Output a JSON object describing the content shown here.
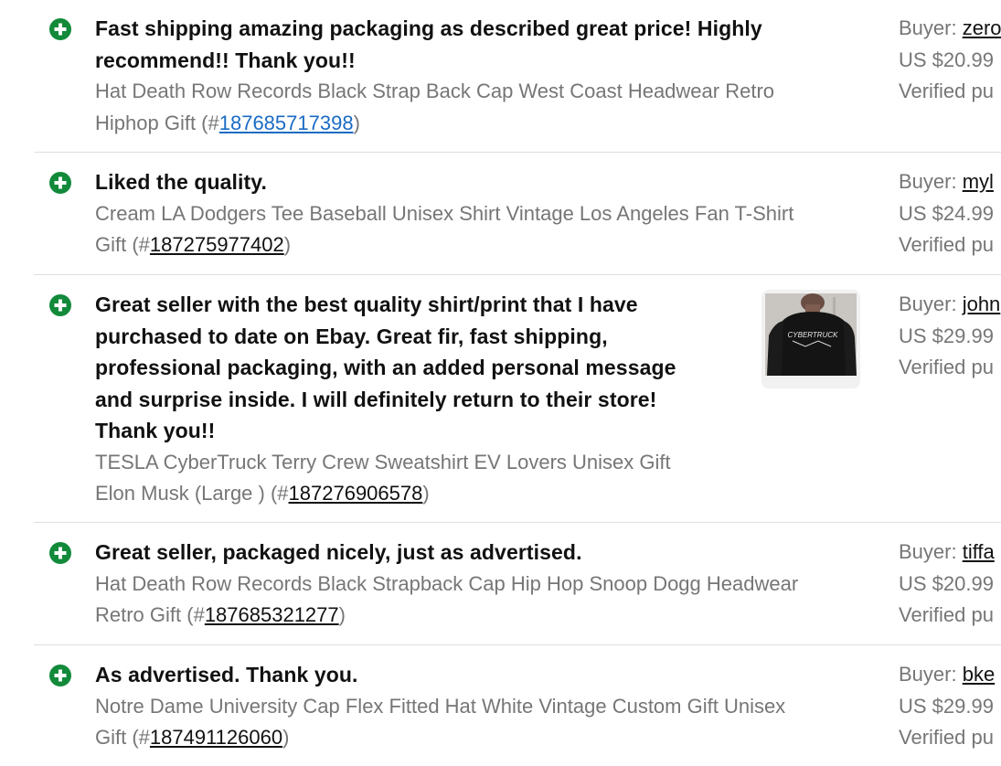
{
  "feedback": [
    {
      "comment_lines": [
        "Fast shipping amazing packaging as described great price! Highly",
        "recommend!! Thank you!!"
      ],
      "item_lines": [
        "Hat Death Row Records Black Strap Back Cap West Coast Headwear Retro"
      ],
      "item_tail_prefix": "Hiphop Gift (#",
      "item_id": "187685717398",
      "item_tail_suffix": ")",
      "buyer_label": "Buyer: ",
      "buyer": "zero",
      "price": "US $20.99",
      "verified": "Verified pu"
    },
    {
      "comment_lines": [
        "Liked the quality."
      ],
      "item_lines": [
        "Cream LA Dodgers Tee Baseball Unisex Shirt Vintage Los Angeles Fan T-Shirt"
      ],
      "item_tail_prefix": "Gift (#",
      "item_id": "187275977402",
      "item_tail_suffix": ")",
      "buyer_label": "Buyer: ",
      "buyer": "myl",
      "price": "US $24.99",
      "verified": "Verified pu"
    },
    {
      "comment_lines": [
        "Great seller with the best quality shirt/print that I have",
        "purchased to date on Ebay. Great fir, fast shipping,",
        "professional packaging, with an added personal message",
        "and surprise inside. I will definitely return to their store!",
        "Thank you!!"
      ],
      "item_lines": [
        "TESLA CyberTruck Terry Crew Sweatshirt EV Lovers Unisex Gift"
      ],
      "item_tail_prefix": "Elon Musk (Large ) (#",
      "item_id": "187276906578",
      "item_tail_suffix": ")",
      "buyer_label": "Buyer: ",
      "buyer": "john",
      "price": "US $29.99",
      "verified": "Verified pu",
      "thumbnail_text": "CYBERTRUCK"
    },
    {
      "comment_lines": [
        "Great seller, packaged nicely, just as advertised."
      ],
      "item_lines": [
        "Hat Death Row Records Black Strapback Cap Hip Hop Snoop Dogg Headwear"
      ],
      "item_tail_prefix": "Retro Gift (#",
      "item_id": "187685321277",
      "item_tail_suffix": ")",
      "buyer_label": "Buyer: ",
      "buyer": "tiffa",
      "price": "US $20.99",
      "verified": "Verified pu"
    },
    {
      "comment_lines": [
        "As advertised. Thank you."
      ],
      "item_lines": [
        "Notre Dame University Cap Flex Fitted Hat White Vintage Custom Gift Unisex"
      ],
      "item_tail_prefix": "Gift (#",
      "item_id": "187491126060",
      "item_tail_suffix": ")",
      "buyer_label": "Buyer: ",
      "buyer": "bke",
      "price": "US $29.99",
      "verified": "Verified pu"
    }
  ],
  "colors": {
    "positive_icon": "#128a3a",
    "link_highlight": "#1a6bc4",
    "muted_text": "#767676",
    "divider": "#dedede"
  },
  "icons": {
    "positive": "plus-circle-icon"
  }
}
